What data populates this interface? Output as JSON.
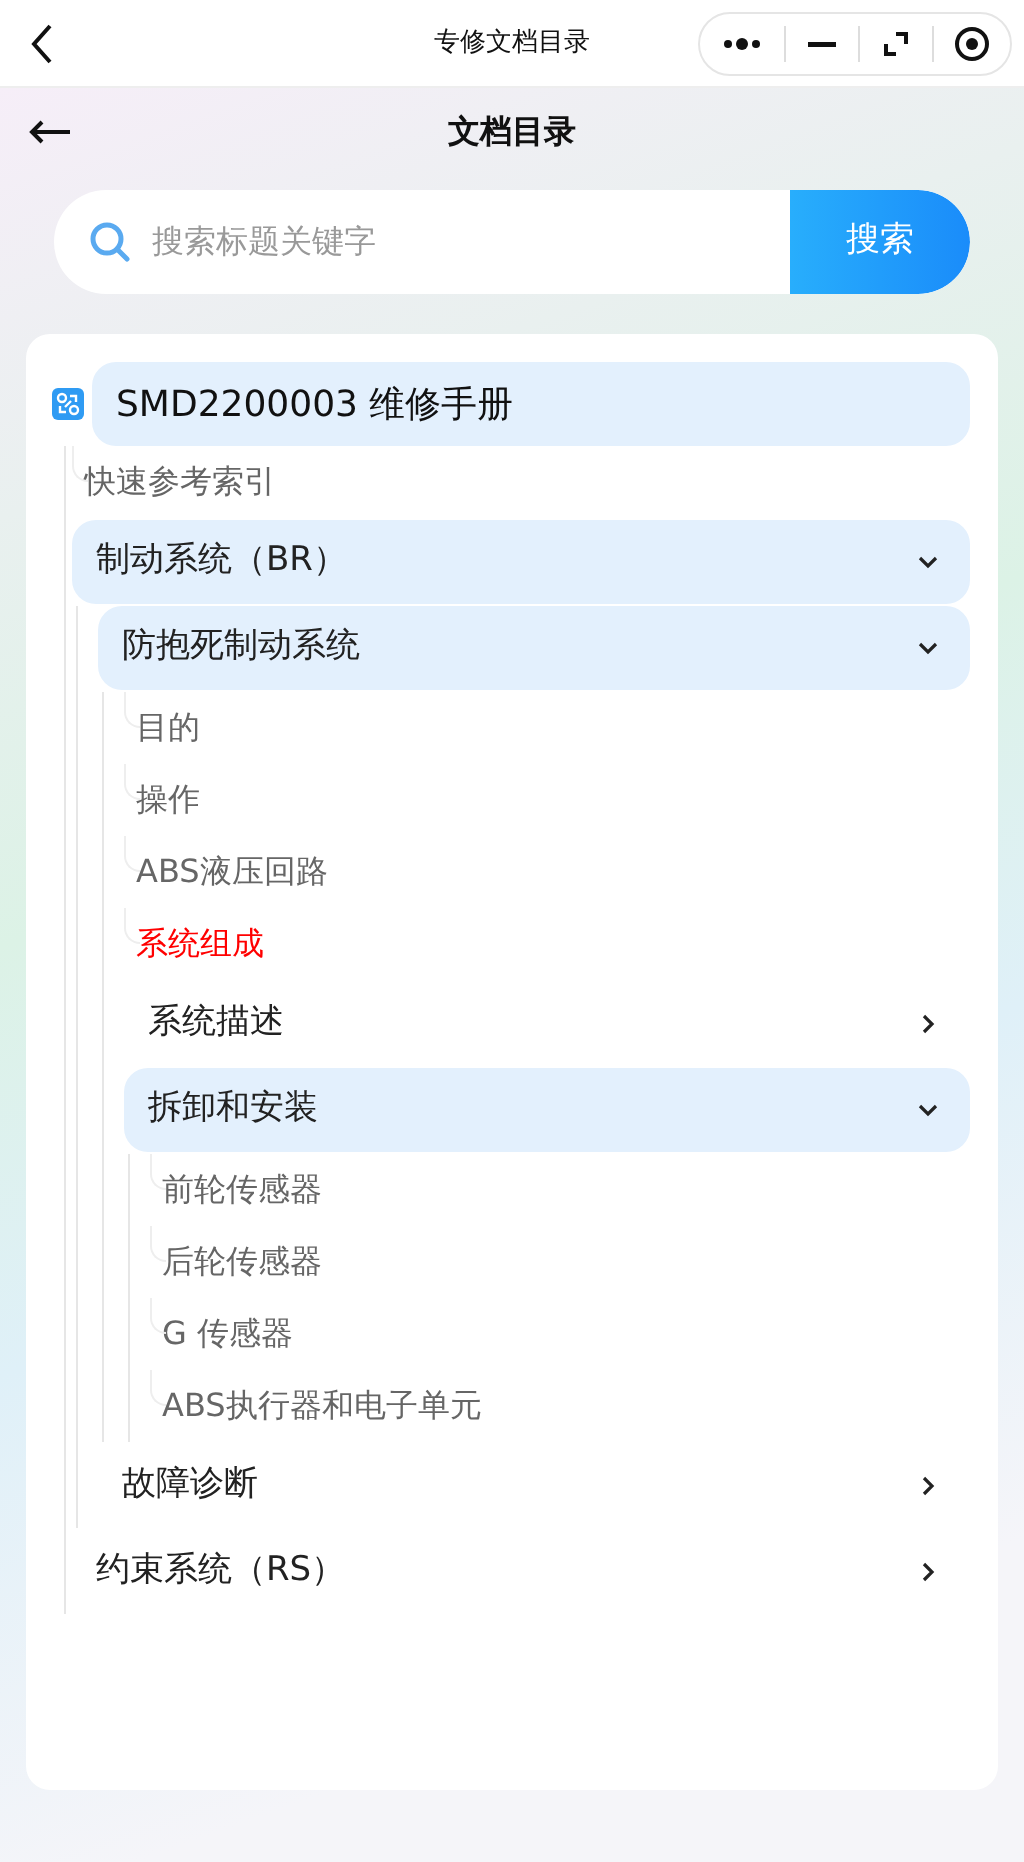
{
  "nav_bar": {
    "title": "专修文档目录"
  },
  "header": {
    "title": "文档目录"
  },
  "search": {
    "placeholder": "搜索标题关键字",
    "button": "搜索"
  },
  "tree": {
    "label": "SMD2200003 维修手册",
    "children": [
      {
        "kind": "leaf",
        "label": "快速参考索引",
        "selected": false
      },
      {
        "kind": "folder",
        "label": "制动系统（BR）",
        "expanded": true,
        "children": [
          {
            "kind": "folder",
            "label": "防抱死制动系统",
            "expanded": true,
            "children": [
              {
                "kind": "leaf",
                "label": "目的",
                "selected": false
              },
              {
                "kind": "leaf",
                "label": "操作",
                "selected": false
              },
              {
                "kind": "leaf",
                "label": "ABS液压回路",
                "selected": false
              },
              {
                "kind": "leaf",
                "label": "系统组成",
                "selected": true
              },
              {
                "kind": "folder",
                "label": "系统描述",
                "expanded": false
              },
              {
                "kind": "folder",
                "label": "拆卸和安装",
                "expanded": true,
                "children": [
                  {
                    "kind": "leaf",
                    "label": "前轮传感器",
                    "selected": false
                  },
                  {
                    "kind": "leaf",
                    "label": "后轮传感器",
                    "selected": false
                  },
                  {
                    "kind": "leaf",
                    "label": "G 传感器",
                    "selected": false
                  },
                  {
                    "kind": "leaf",
                    "label": "ABS执行器和电子单元",
                    "selected": false
                  }
                ]
              }
            ]
          },
          {
            "kind": "folder",
            "label": "故障诊断",
            "expanded": false
          }
        ]
      },
      {
        "kind": "folder",
        "label": "约束系统（RS）",
        "expanded": false
      }
    ]
  }
}
